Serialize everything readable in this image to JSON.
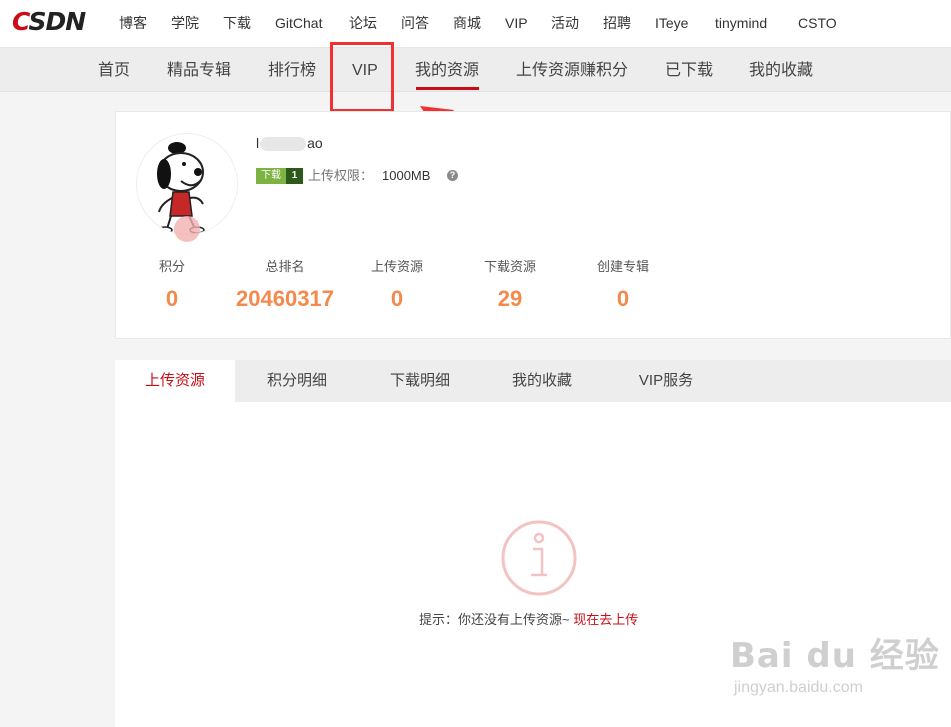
{
  "logo": {
    "c": "C",
    "rest": "SDN"
  },
  "topnav": [
    "博客",
    "学院",
    "下载",
    "GitChat",
    "论坛",
    "问答",
    "商城",
    "VIP",
    "活动",
    "招聘",
    "ITeye",
    "tinymind",
    "CSTO"
  ],
  "subnav": [
    "首页",
    "精品专辑",
    "排行榜",
    "VIP",
    "我的资源",
    "上传资源赚积分",
    "已下载",
    "我的收藏"
  ],
  "profile": {
    "name_prefix": "l",
    "name_suffix": "ao",
    "download_tag": "下载",
    "download_level": "1",
    "upload_permission_label": "上传权限：",
    "upload_permission_value": "1000MB",
    "help_glyph": "?"
  },
  "stats": [
    {
      "label": "积分",
      "value": "0"
    },
    {
      "label": "总排名",
      "value": "20460317"
    },
    {
      "label": "上传资源",
      "value": "0"
    },
    {
      "label": "下载资源",
      "value": "29"
    },
    {
      "label": "创建专辑",
      "value": "0"
    }
  ],
  "tabs": [
    "上传资源",
    "积分明细",
    "下载明细",
    "我的收藏",
    "VIP服务"
  ],
  "empty_state": {
    "tip": "提示：你还没有上传资源~ ",
    "link": "现在去上传"
  },
  "watermark": {
    "main": "Bai du 经验",
    "sub": "jingyan.baidu.com"
  },
  "colors": {
    "brand": "#ca0c16",
    "stat": "#f4894b",
    "annotation": "#f13131"
  }
}
